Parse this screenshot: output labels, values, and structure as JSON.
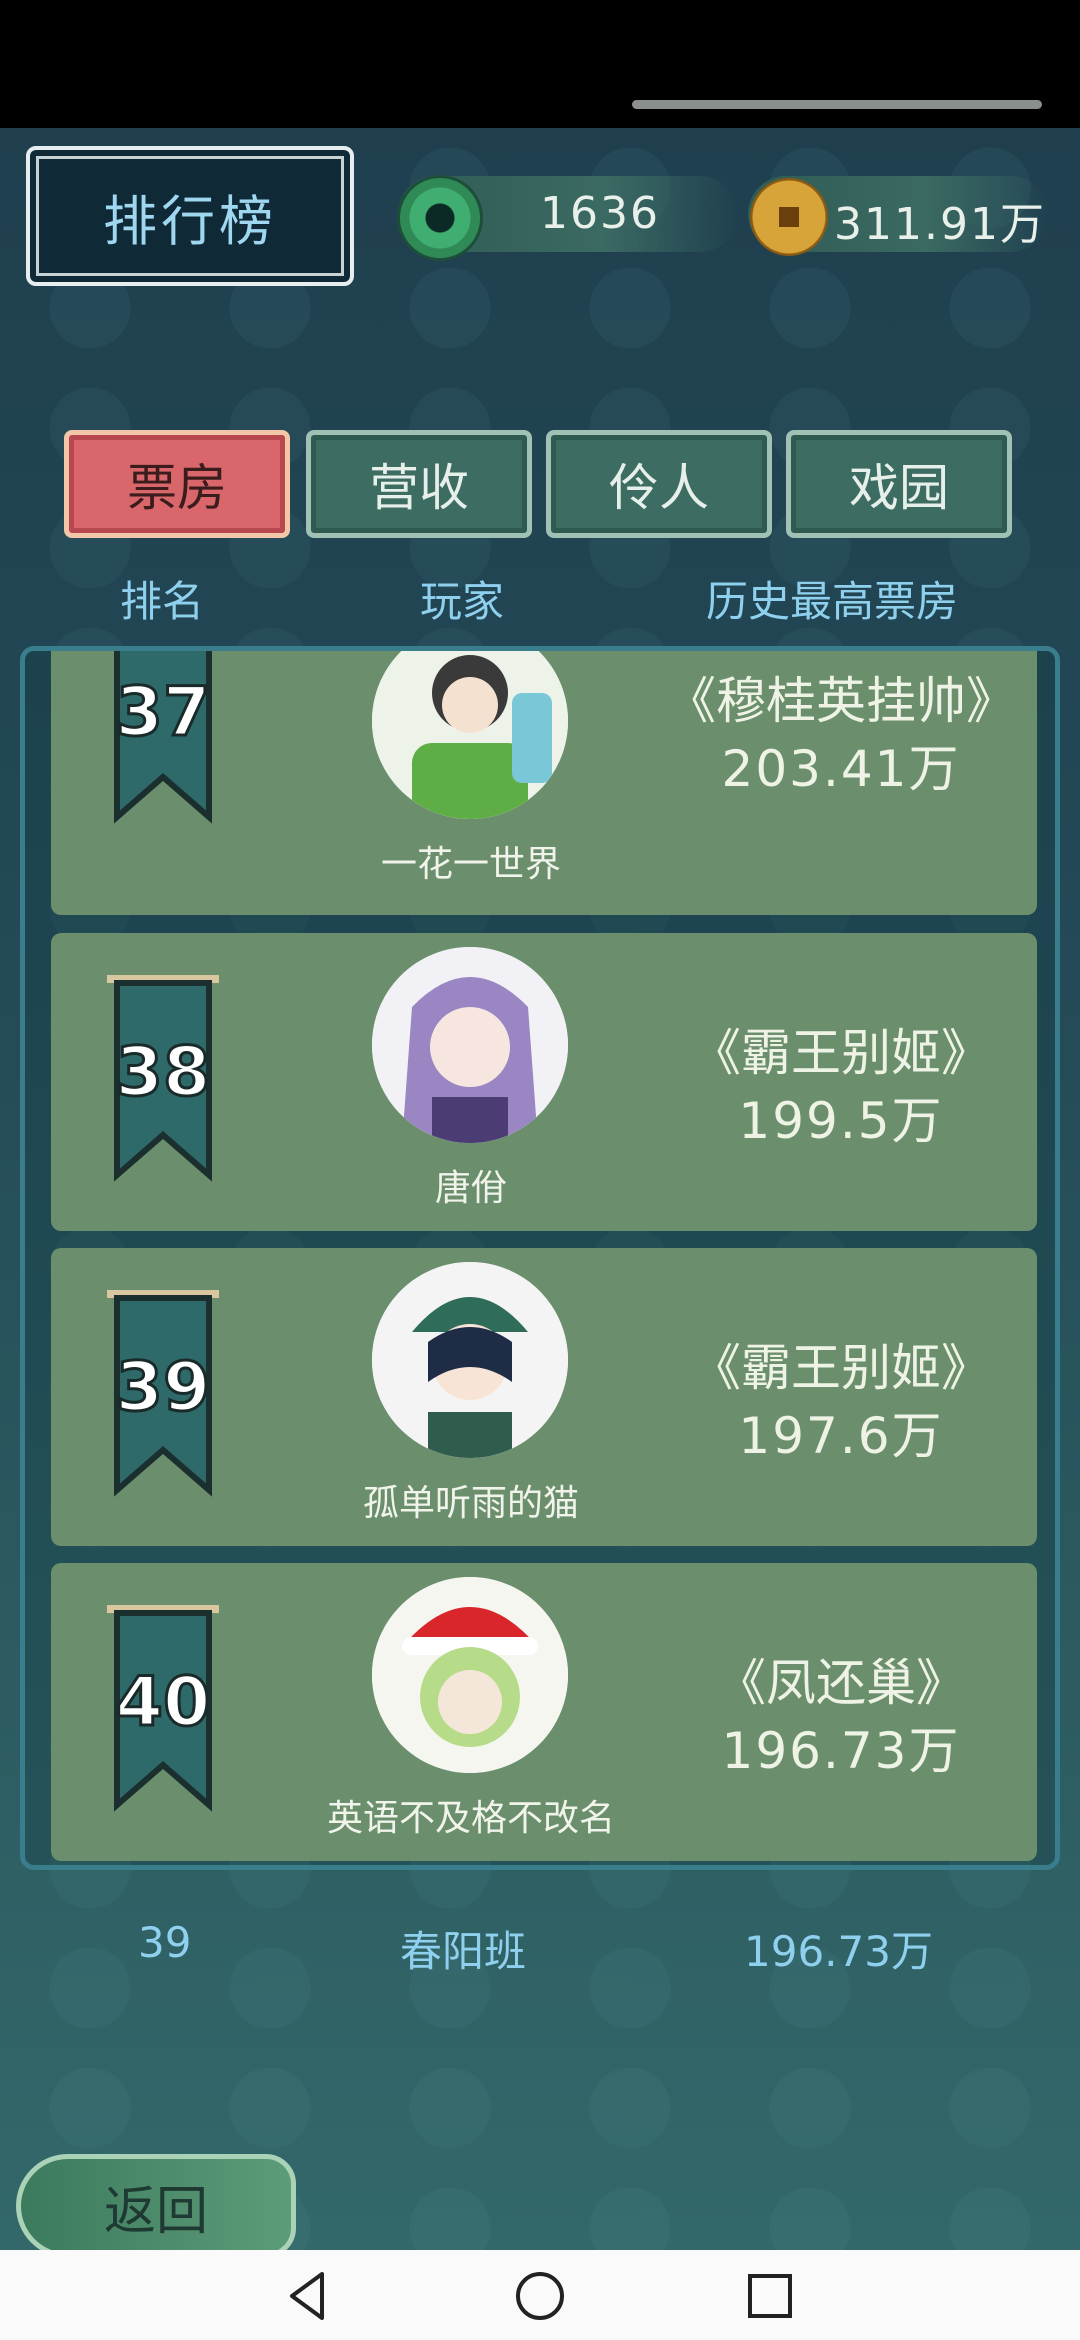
{
  "header": {
    "title": "排行榜",
    "jade_value": "1636",
    "coin_value": "311.91万"
  },
  "tabs": [
    {
      "label": "票房",
      "active": true
    },
    {
      "label": "营收",
      "active": false
    },
    {
      "label": "伶人",
      "active": false
    },
    {
      "label": "戏园",
      "active": false
    }
  ],
  "columns": {
    "rank": "排名",
    "player": "玩家",
    "box_office": "历史最高票房"
  },
  "rows": [
    {
      "rank": "37",
      "player": "一花一世界",
      "play": "《穆桂英挂帅》",
      "value": "203.41万"
    },
    {
      "rank": "38",
      "player": "唐佾",
      "play": "《霸王别姬》",
      "value": "199.5万"
    },
    {
      "rank": "39",
      "player": "孤单听雨的猫",
      "play": "《霸王别姬》",
      "value": "197.6万"
    },
    {
      "rank": "40",
      "player": "英语不及格不改名",
      "play": "《凤还巢》",
      "value": "196.73万"
    }
  ],
  "my_rank": {
    "rank": "39",
    "player": "春阳班",
    "value": "196.73万"
  },
  "back_label": "返回",
  "icons": [
    "jade-icon",
    "coin-icon",
    "banner-icon",
    "back-nav-icon",
    "home-nav-icon",
    "recents-nav-icon"
  ]
}
